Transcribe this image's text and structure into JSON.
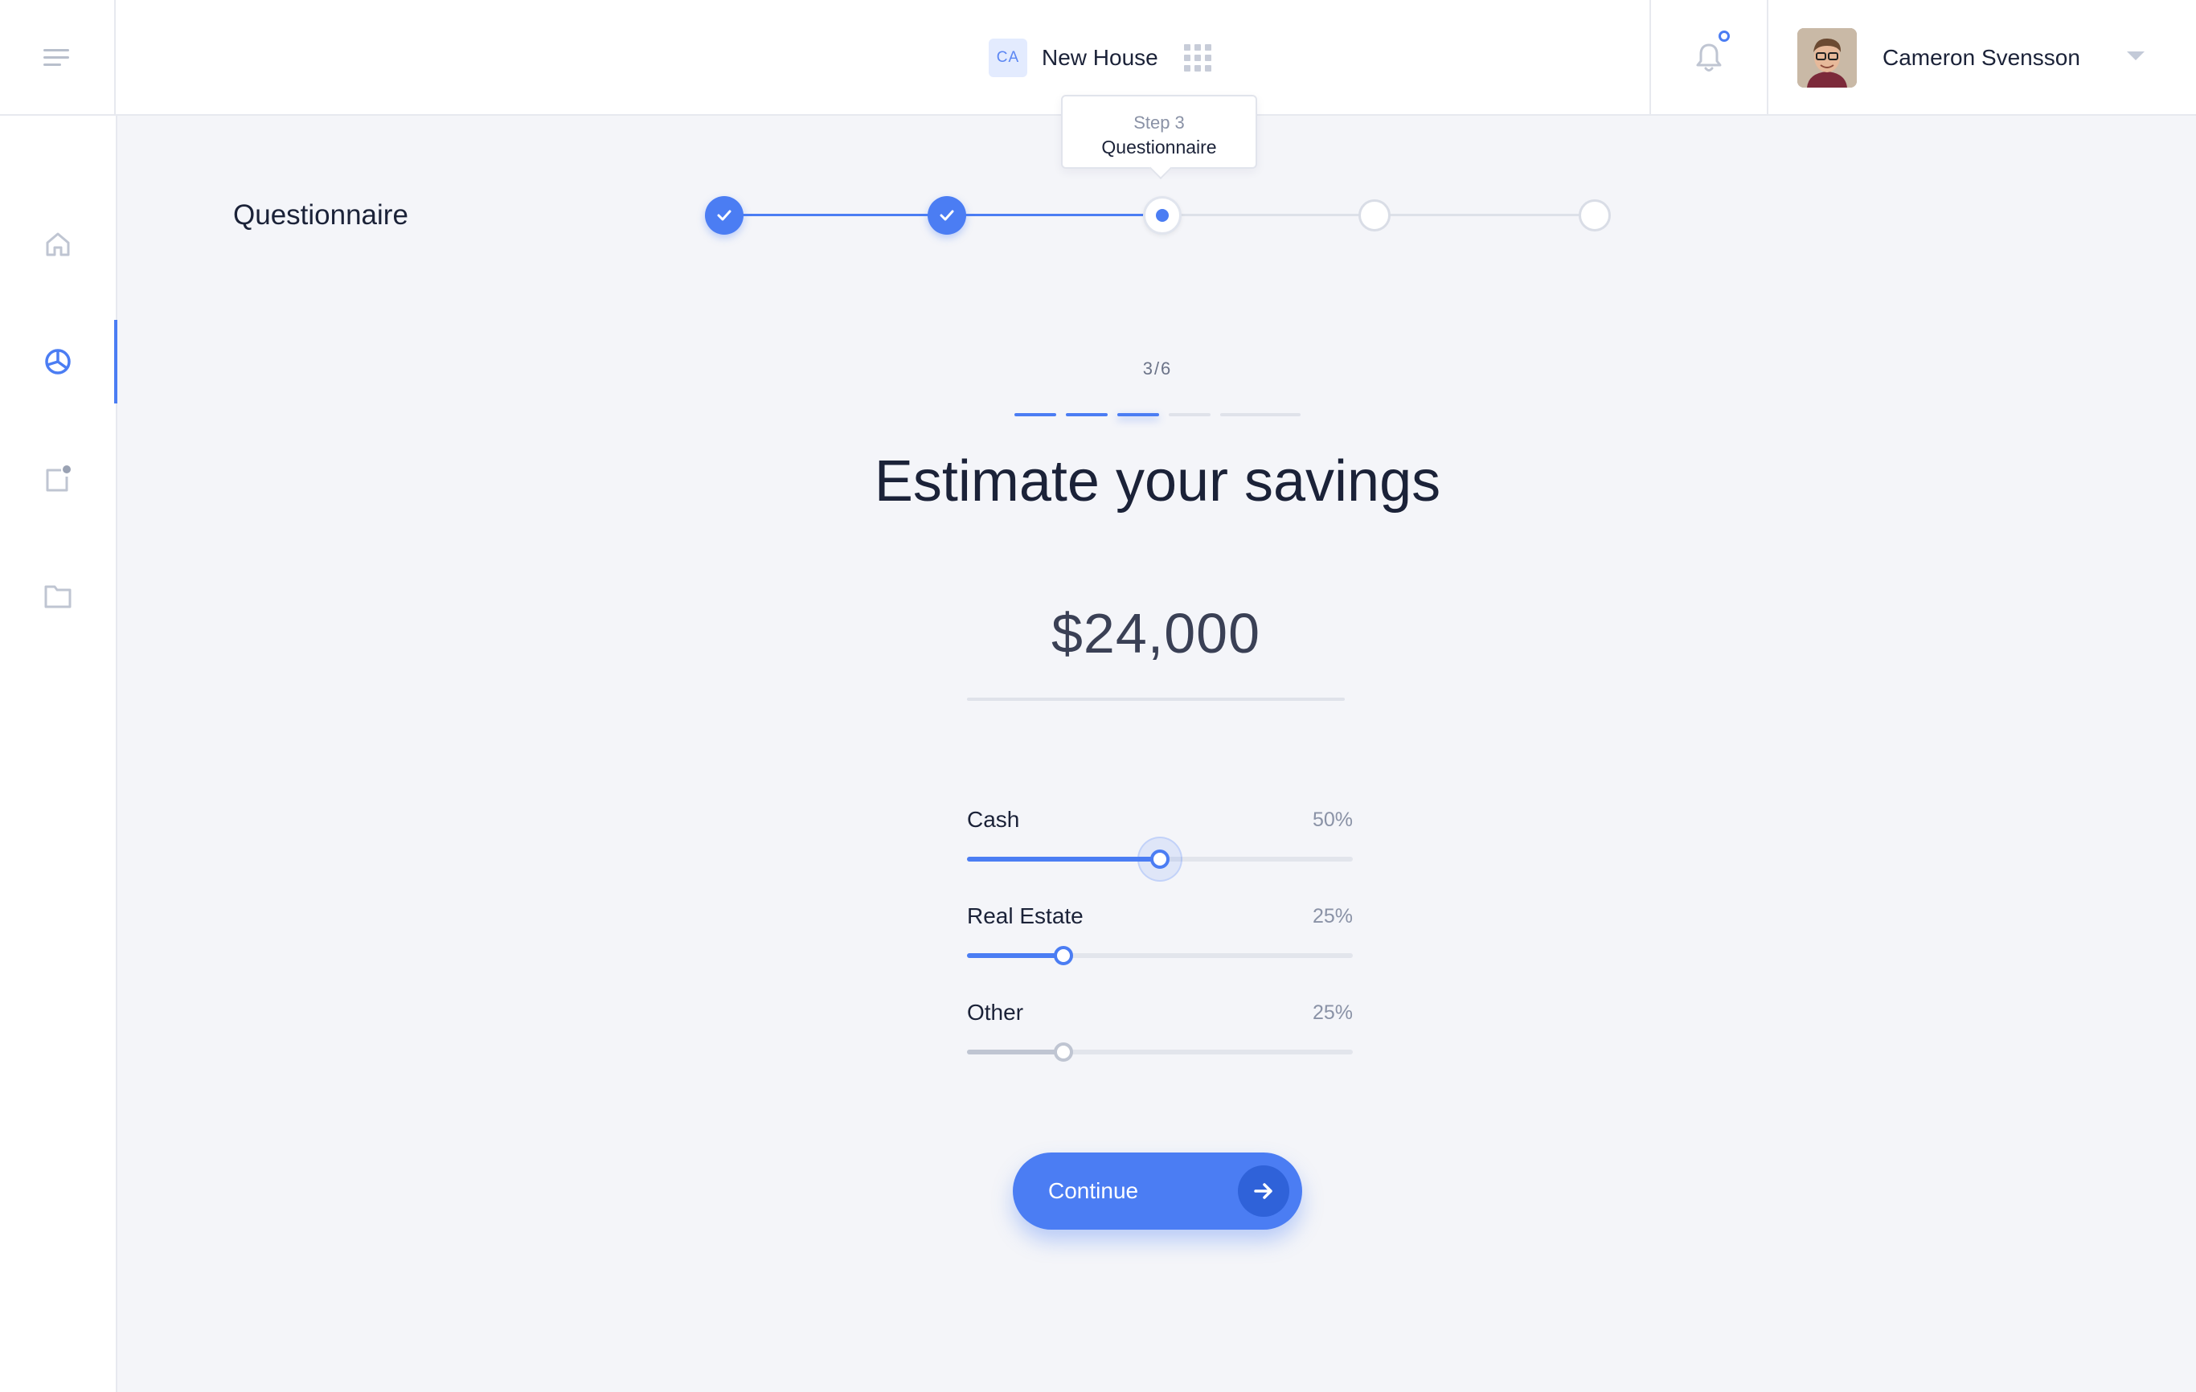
{
  "header": {
    "project_badge": "CA",
    "project_name": "New House",
    "user_name": "Cameron Svensson"
  },
  "sidebar": {
    "items": [
      {
        "icon": "home-icon",
        "active": false
      },
      {
        "icon": "pie-chart-icon",
        "active": true
      },
      {
        "icon": "notification-square-icon",
        "active": false
      },
      {
        "icon": "folder-icon",
        "active": false
      }
    ]
  },
  "page": {
    "title": "Questionnaire"
  },
  "stepper": {
    "total_steps": 5,
    "completed": 2,
    "current": 3,
    "tooltip_step": "Step 3",
    "tooltip_label": "Questionnaire"
  },
  "progress": {
    "counter": "3/6"
  },
  "question": {
    "heading": "Estimate your savings",
    "amount": "$24,000"
  },
  "allocations": [
    {
      "label": "Cash",
      "percent_text": "50%",
      "value": 0.5
    },
    {
      "label": "Real Estate",
      "percent_text": "25%",
      "value": 0.25
    },
    {
      "label": "Other",
      "percent_text": "25%",
      "value": 0.25
    }
  ],
  "actions": {
    "continue_label": "Continue"
  },
  "colors": {
    "accent": "#4b7df3",
    "muted": "#bfc5d2"
  }
}
